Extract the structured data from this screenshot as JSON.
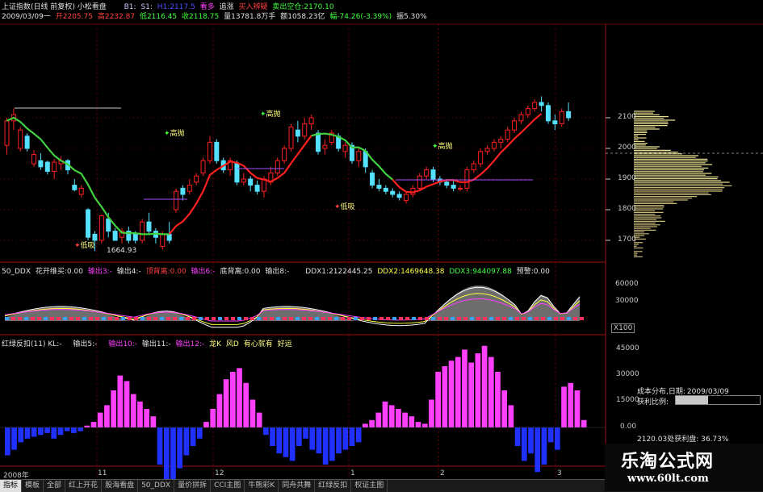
{
  "header": {
    "title": "上证指数(日线 前复权) 小松看盘",
    "b1": "B1:",
    "s1": "S1:",
    "p1": "H1:2117.5",
    "kd": "看多",
    "zx": "追涨",
    "mrsb": "买入辨疑",
    "mckk": "卖出空仓:2170.10",
    "date": "2009/03/09一",
    "open": "开2205.75",
    "high": "高2232.87",
    "low": "低2116.45",
    "close": "收2118.75",
    "vol": "量13781.8万手",
    "amt": "额1058.23亿",
    "chg": "幅-74.26(-3.39%)",
    "amp": "振5.30%"
  },
  "main_chart": {
    "labels": {
      "gaopao1": "高抛",
      "gaopao2": "高抛",
      "gaopao3": "高抛",
      "dixi1": "低吸",
      "dixi2": "低吸",
      "low_val": "1664.93"
    },
    "yaxis": [
      "2100",
      "2000",
      "1900",
      "1800",
      "1700"
    ],
    "candles": [
      [
        2010,
        2090,
        1980,
        2100
      ],
      [
        2090,
        2110,
        2060,
        2130
      ],
      [
        2000,
        2060,
        1990,
        2070
      ],
      [
        2040,
        2000,
        1990,
        2050
      ],
      [
        1950,
        1980,
        1940,
        1995
      ],
      [
        1960,
        1940,
        1930,
        1985
      ],
      [
        1955,
        1925,
        1915,
        1960
      ],
      [
        1925,
        1955,
        1900,
        1965
      ],
      [
        1950,
        1960,
        1930,
        1975
      ],
      [
        1960,
        1930,
        1915,
        1965
      ],
      [
        1880,
        1865,
        1860,
        1900
      ],
      [
        1850,
        1870,
        1840,
        1880
      ],
      [
        1800,
        1710,
        1700,
        1805
      ],
      [
        1720,
        1700,
        1665,
        1730
      ],
      [
        1700,
        1780,
        1690,
        1785
      ],
      [
        1770,
        1730,
        1710,
        1790
      ],
      [
        1730,
        1700,
        1700,
        1740
      ],
      [
        1710,
        1730,
        1690,
        1740
      ],
      [
        1730,
        1700,
        1690,
        1745
      ],
      [
        1720,
        1700,
        1690,
        1730
      ],
      [
        1700,
        1760,
        1690,
        1770
      ],
      [
        1760,
        1730,
        1720,
        1790
      ],
      [
        1730,
        1710,
        1690,
        1740
      ],
      [
        1680,
        1720,
        1670,
        1730
      ],
      [
        1720,
        1700,
        1690,
        1760
      ],
      [
        1800,
        1860,
        1790,
        1870
      ],
      [
        1870,
        1850,
        1830,
        1880
      ],
      [
        1860,
        1880,
        1850,
        1900
      ],
      [
        1890,
        1910,
        1880,
        1920
      ],
      [
        1920,
        1960,
        1910,
        1970
      ],
      [
        1960,
        2020,
        1950,
        2040
      ],
      [
        2020,
        1960,
        1950,
        2030
      ],
      [
        1960,
        1930,
        1920,
        1970
      ],
      [
        1930,
        1960,
        1910,
        1970
      ],
      [
        1950,
        1890,
        1880,
        1960
      ],
      [
        1890,
        1900,
        1880,
        1920
      ],
      [
        1900,
        1880,
        1860,
        1910
      ],
      [
        1880,
        1860,
        1850,
        1895
      ],
      [
        1860,
        1900,
        1840,
        1910
      ],
      [
        1890,
        1920,
        1880,
        1940
      ],
      [
        1920,
        1960,
        1910,
        1970
      ],
      [
        1960,
        2000,
        1950,
        2010
      ],
      [
        2000,
        2070,
        1990,
        2080
      ],
      [
        2060,
        2040,
        2020,
        2090
      ],
      [
        2040,
        2080,
        2030,
        2100
      ],
      [
        2080,
        2100,
        2060,
        2110
      ],
      [
        2050,
        1990,
        1980,
        2060
      ],
      [
        2000,
        2010,
        1980,
        2030
      ],
      [
        2020,
        2050,
        2010,
        2060
      ],
      [
        2040,
        2000,
        1990,
        2050
      ],
      [
        1990,
        2010,
        1970,
        2020
      ],
      [
        2010,
        1960,
        1950,
        2020
      ],
      [
        1960,
        1990,
        1940,
        2000
      ],
      [
        1990,
        1940,
        1920,
        2000
      ],
      [
        1920,
        1880,
        1870,
        1930
      ],
      [
        1880,
        1870,
        1860,
        1900
      ],
      [
        1870,
        1860,
        1850,
        1880
      ],
      [
        1860,
        1850,
        1840,
        1870
      ],
      [
        1850,
        1840,
        1830,
        1860
      ],
      [
        1830,
        1850,
        1820,
        1860
      ],
      [
        1850,
        1870,
        1840,
        1880
      ],
      [
        1870,
        1910,
        1860,
        1920
      ],
      [
        1910,
        1930,
        1900,
        1940
      ],
      [
        1930,
        1900,
        1890,
        1940
      ],
      [
        1900,
        1890,
        1880,
        1910
      ],
      [
        1890,
        1880,
        1870,
        1900
      ],
      [
        1880,
        1870,
        1860,
        1900
      ],
      [
        1870,
        1870,
        1860,
        1880
      ],
      [
        1870,
        1930,
        1860,
        1940
      ],
      [
        1930,
        1950,
        1920,
        1960
      ],
      [
        1950,
        1990,
        1940,
        2000
      ],
      [
        1990,
        2000,
        1980,
        2010
      ],
      [
        2000,
        2020,
        1990,
        2030
      ],
      [
        2020,
        2030,
        2000,
        2040
      ],
      [
        2030,
        2060,
        2020,
        2070
      ],
      [
        2060,
        2090,
        2050,
        2100
      ],
      [
        2090,
        2110,
        2080,
        2120
      ],
      [
        2110,
        2130,
        2100,
        2140
      ],
      [
        2130,
        2150,
        2120,
        2160
      ],
      [
        2150,
        2140,
        2120,
        2170
      ],
      [
        2140,
        2090,
        2080,
        2150
      ],
      [
        2090,
        2080,
        2060,
        2110
      ],
      [
        2080,
        2120,
        2070,
        2130
      ],
      [
        2120,
        2100,
        2090,
        2150
      ]
    ]
  },
  "ddx_panel": {
    "title": "50_DDX",
    "hkc": "花开维买:0.00",
    "sc3": "输出3:-",
    "sc4": "输出4:-",
    "dbj": "顶背离:0.00",
    "sc6": "输出6:-",
    "dbx": "底背离:0.00",
    "sc8": "输出8:-",
    "ddx1": "DDX1:2122445.25",
    "ddx2": "DDX2:1469648.38",
    "ddx3": "DDX3:944097.88",
    "yj": "预警:0.00",
    "yaxis": [
      "60000",
      "30000"
    ],
    "unit": "X100"
  },
  "hlfk_panel": {
    "title": "红绿反扣(11) KL:-",
    "sc5": "输出5:-",
    "sc10": "输出10:-",
    "sc11": "输出11:-",
    "sc12": "输出12:-",
    "lk": "龙K",
    "fd": "风D",
    "yxjy": "有心就有",
    "hy": "好运",
    "yaxis": [
      "45000",
      "30000",
      "15000",
      "0.00"
    ],
    "values": [
      -15000,
      -12000,
      -8000,
      -6000,
      -5000,
      -4000,
      -3000,
      -6000,
      -4000,
      -2000,
      -3000,
      -2000,
      1000,
      3000,
      8000,
      12000,
      20000,
      28000,
      25000,
      18000,
      14000,
      10000,
      6000,
      -20000,
      -28000,
      -30000,
      -22000,
      -15000,
      -10000,
      -6000,
      3000,
      10000,
      18000,
      26000,
      30000,
      32000,
      24000,
      15000,
      8000,
      -4000,
      -10000,
      -14000,
      -16000,
      -18000,
      -10000,
      -6000,
      -12000,
      -14000,
      -20000,
      -18000,
      -14000,
      -12000,
      -10000,
      -8000,
      2000,
      4000,
      8000,
      14000,
      12000,
      10000,
      8000,
      6000,
      3000,
      2000,
      15000,
      30000,
      33000,
      36000,
      38000,
      42000,
      35000,
      40000,
      44000,
      38000,
      30000,
      20000,
      12000,
      -10000,
      -18000,
      -14000,
      -24000,
      -20000,
      -8000,
      -12000,
      22000,
      24000,
      20000,
      4000
    ]
  },
  "side_panel": {
    "yaxis_main": [
      "2100",
      "2000",
      "1900",
      "1800",
      "1700"
    ],
    "cost_title": "成本分布,日期:",
    "cost_date": "2009/03/09",
    "profit_label": "获利比例:",
    "profit_val": "36.7%",
    "cost_row2": "2120.03处获利盘: 36.73%"
  },
  "xaxis": {
    "labels": [
      "2008年",
      "11",
      "12",
      "1",
      "2",
      "3"
    ]
  },
  "tabs": [
    "指标",
    "模板",
    "全部",
    "红上开花",
    "股海看盘",
    "50_DDX",
    "量价拼拆",
    "CCI主图",
    "牛熊彩K",
    "同舟共舞",
    "红绿反扣",
    "权证主图"
  ],
  "watermark": {
    "brand": "乐淘公式网",
    "url": "www.60lt.com"
  },
  "colors": {
    "up": "#ff2020",
    "down": "#54e0ff",
    "ma_green": "#40d040",
    "ma_red": "#ff2020",
    "magenta": "#ff40ff",
    "blue": "#2030ff",
    "grid": "#6a0000"
  }
}
